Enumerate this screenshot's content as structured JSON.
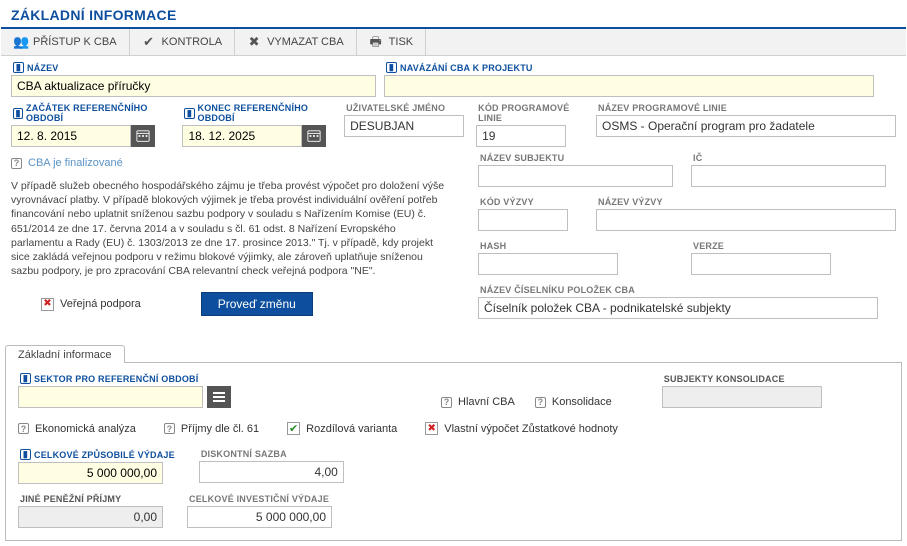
{
  "page_title": "ZÁKLADNÍ INFORMACE",
  "toolbar": {
    "access": "PŘÍSTUP K CBA",
    "kontrola": "KONTROLA",
    "vymazat": "VYMAZAT CBA",
    "tisk": "TISK"
  },
  "form": {
    "nazev_label": "NÁZEV",
    "nazev_value": "CBA aktualizace příručky",
    "navazani_label": "NAVÁZÁNÍ CBA K PROJEKTU",
    "navazani_value": "",
    "zacatek_label": "ZAČÁTEK REFERENČNÍHO OBDOBÍ",
    "zacatek_value": "12. 8. 2015",
    "konec_label": "KONEC REFERENČNÍHO OBDOBÍ",
    "konec_value": "18. 12. 2025",
    "uzivatel_label": "UŽIVATELSKÉ JMÉNO",
    "uzivatel_value": "DESUBJAN",
    "kodlinie_label": "KÓD PROGRAMOVÉ LINIE",
    "kodlinie_value": "19",
    "nazevlinie_label": "NÁZEV PROGRAMOVÉ LINIE",
    "nazevlinie_value": "OSMS - Operační program pro žadatele",
    "finalized_label": "CBA je finalizované",
    "explain_text": "V případě služeb obecného hospodářského zájmu je třeba provést výpočet pro doložení výše vyrovnávací platby. V případě blokových výjimek je třeba provést individuální ověření potřeb financování nebo uplatnit sníženou sazbu podpory v souladu s Nařízením Komise (EU) č. 651/2014 ze dne 17. června 2014 a v souladu s čl. 61 odst. 8 Nařízení Evropského parlamentu a Rady (EU) č. 1303/2013 ze dne 17. prosince 2013.\" Tj. v případě, kdy projekt sice zakládá veřejnou podporu v režimu blokové výjimky, ale zároveň uplatňuje sníženou sazbu podpory, je pro zpracování CBA relevantní check veřejná podpora \"NE\".",
    "verejna_podpora_label": "Veřejná podpora",
    "proved_zmenu": "Proveď změnu",
    "nazev_subjektu_label": "NÁZEV SUBJEKTU",
    "ic_label": "IČ",
    "kod_vyzvy_label": "KÓD VÝZVY",
    "nazev_vyzvy_label": "NÁZEV VÝZVY",
    "hash_label": "HASH",
    "verze_label": "VERZE",
    "ciselnik_label": "NÁZEV ČÍSELNÍKU POLOŽEK CBA",
    "ciselnik_value": "Číselník položek CBA - podnikatelské subjekty"
  },
  "tab": {
    "basic": "Základní informace"
  },
  "panel": {
    "sektor_label": "SEKTOR PRO REFERENČNÍ OBDOBÍ",
    "hlavni_cba": "Hlavní CBA",
    "konsolidace_label": "Konsolidace",
    "subjekty_kons_label": "SUBJEKTY KONSOLIDACE",
    "ekon_analyza": "Ekonomická analýza",
    "prijmy_cl61": "Příjmy dle čl. 61",
    "rozdilova": "Rozdílová varianta",
    "vlastni_vypocet": "Vlastní výpočet Zůstatkové hodnoty",
    "celkove_vydaje_label": "CELKOVÉ ZPŮSOBILÉ VÝDAJE",
    "celkove_vydaje_value": "5 000 000,00",
    "diskontni_label": "DISKONTNÍ SAZBA",
    "diskontni_value": "4,00",
    "jine_prijmy_label": "JINÉ PENĚŽNÍ PŘÍJMY",
    "jine_prijmy_value": "0,00",
    "investicni_label": "CELKOVÉ INVESTIČNÍ VÝDAJE",
    "investicni_value": "5 000 000,00"
  }
}
